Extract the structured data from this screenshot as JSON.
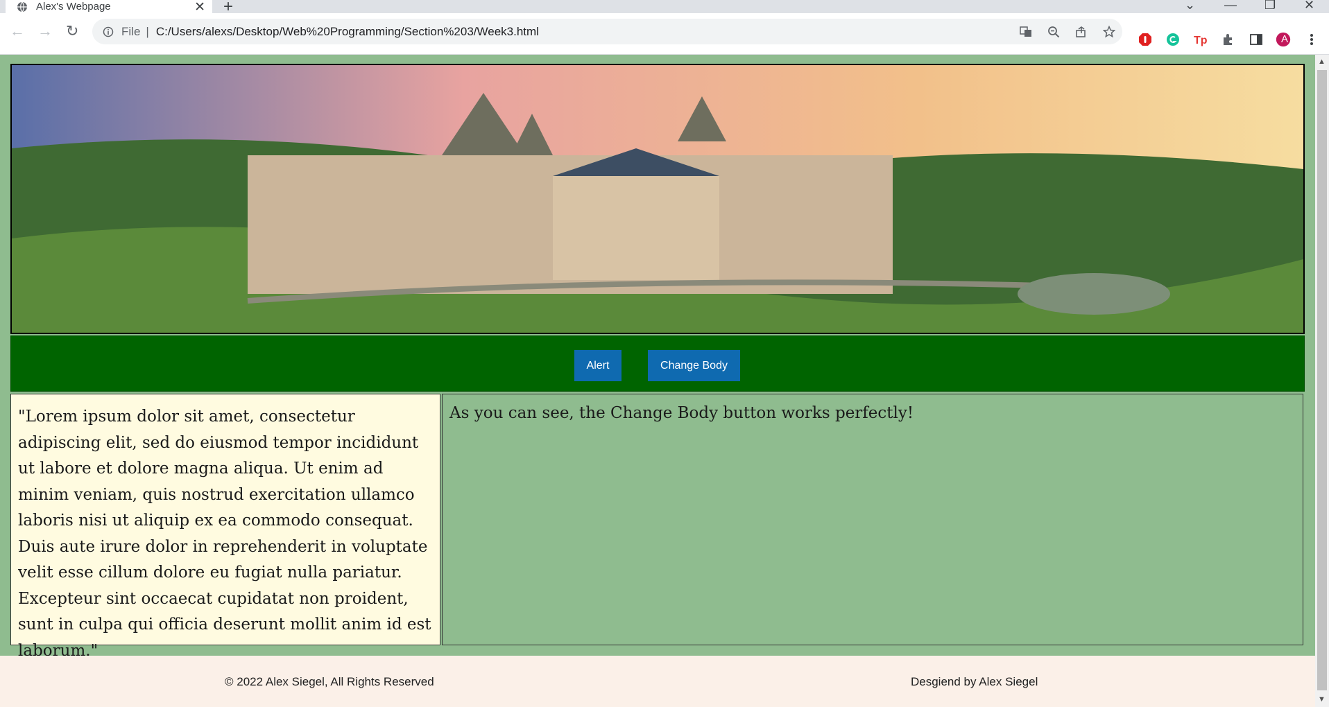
{
  "browser": {
    "tab_title": "Alex's Webpage",
    "tab_close": "✕",
    "new_tab": "+",
    "window_controls": {
      "tab_search": "⌄",
      "minimize": "—",
      "restore": "❐",
      "close": "✕"
    },
    "nav": {
      "back": "←",
      "forward": "→",
      "reload": "↻"
    },
    "address": {
      "scheme_label": "File",
      "separator": "|",
      "url": "C:/Users/alexs/Desktop/Web%20Programming/Section%203/Week3.html"
    },
    "profile_initial": "A"
  },
  "page": {
    "buttons": {
      "alert": "Alert",
      "change_body": "Change Body"
    },
    "lorem": "\"Lorem ipsum dolor sit amet, consectetur adipiscing elit, sed do eiusmod tempor incididunt ut labore et dolore magna aliqua. Ut enim ad minim veniam, quis nostrud exercitation ullamco laboris nisi ut aliquip ex ea commodo consequat. Duis aute irure dolor in reprehenderit in voluptate velit esse cillum dolore eu fugiat nulla pariatur. Excepteur sint occaecat cupidatat non proident, sunt in culpa qui officia deserunt mollit anim id est laborum.\"",
    "body_text": "As you can see, the Change Body button works perfectly!",
    "footer": {
      "copyright": "© 2022 Alex Siegel, All Rights Reserved",
      "designed": "Desgiend by Alex Siegel"
    }
  },
  "colors": {
    "page_bg": "#8fbc8f",
    "nav_bar": "#006400",
    "button": "#0f6ab0",
    "left_panel": "#fffbe0",
    "footer": "#fbf0e8"
  }
}
